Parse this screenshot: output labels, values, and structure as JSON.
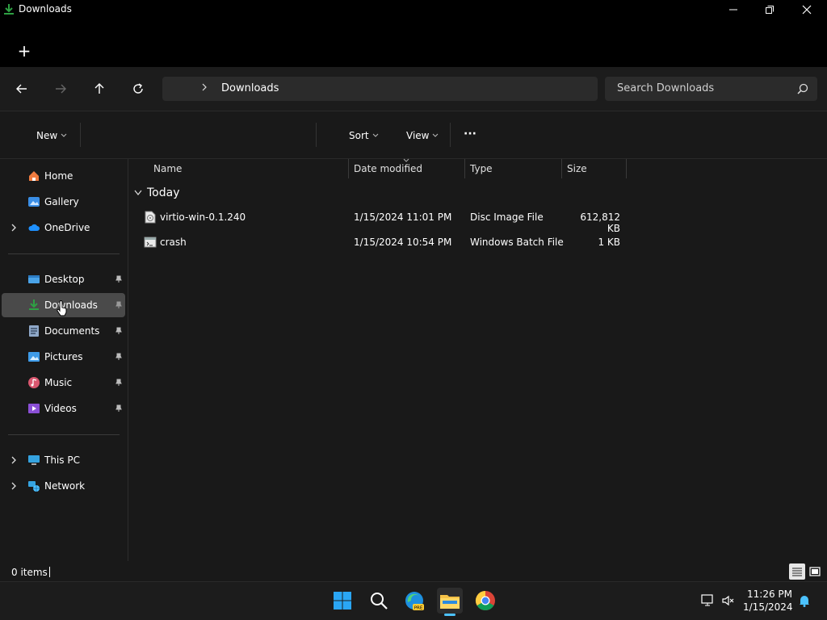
{
  "window": {
    "title": "Downloads"
  },
  "tabbar": {
    "new_tab_label": "+"
  },
  "address": {
    "current": "Downloads"
  },
  "search": {
    "placeholder": "Search Downloads"
  },
  "toolbar": {
    "new_label": "New",
    "sort_label": "Sort",
    "view_label": "View",
    "more_label": "···"
  },
  "sidebar": {
    "quick": [
      {
        "label": "Home",
        "icon": "home-icon"
      },
      {
        "label": "Gallery",
        "icon": "gallery-icon"
      },
      {
        "label": "OneDrive",
        "icon": "cloud-icon",
        "expandable": true
      }
    ],
    "pinned": [
      {
        "label": "Desktop",
        "icon": "desktop-icon",
        "pinned": true
      },
      {
        "label": "Downloads",
        "icon": "download-icon",
        "pinned": true,
        "selected": true
      },
      {
        "label": "Documents",
        "icon": "documents-icon",
        "pinned": true
      },
      {
        "label": "Pictures",
        "icon": "pictures-icon",
        "pinned": true
      },
      {
        "label": "Music",
        "icon": "music-icon",
        "pinned": true
      },
      {
        "label": "Videos",
        "icon": "videos-icon",
        "pinned": true
      }
    ],
    "locations": [
      {
        "label": "This PC",
        "icon": "pc-icon",
        "expandable": true
      },
      {
        "label": "Network",
        "icon": "network-icon",
        "expandable": true
      }
    ]
  },
  "columns": {
    "name": "Name",
    "date": "Date modified",
    "type": "Type",
    "size": "Size"
  },
  "groups": [
    {
      "label": "Today",
      "files": [
        {
          "name": "virtio-win-0.1.240",
          "date": "1/15/2024 11:01 PM",
          "type": "Disc Image File",
          "size": "612,812 KB",
          "icon": "disc-image-icon"
        },
        {
          "name": "crash",
          "date": "1/15/2024 10:54 PM",
          "type": "Windows Batch File",
          "size": "1 KB",
          "icon": "batch-file-icon"
        }
      ]
    }
  ],
  "status": {
    "items": "0 items"
  },
  "taskbar": {
    "time": "11:26 PM",
    "date": "1/15/2024"
  },
  "colors": {
    "accent": "#0078d4",
    "download_green": "#2ea043",
    "folder_yellow": "#f5c146"
  }
}
